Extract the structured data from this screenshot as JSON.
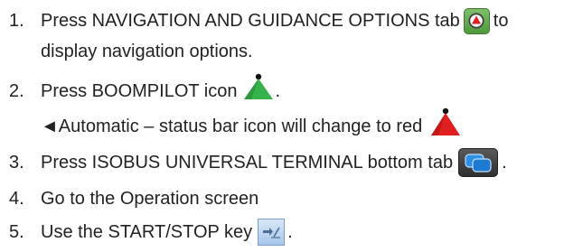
{
  "steps": [
    {
      "number": "1.",
      "text_a": "Press NAVIGATION AND GUIDANCE OPTIONS tab",
      "text_b": "to",
      "continuation": "display navigation options."
    },
    {
      "number": "2.",
      "text_a": "Press BOOMPILOT icon",
      "text_b": "."
    },
    {
      "note_arrow": "◄",
      "note_text": "Automatic – status bar icon will change to red"
    },
    {
      "number": "3.",
      "text_a": "Press ISOBUS UNIVERSAL TERMINAL bottom tab",
      "text_b": "."
    },
    {
      "number": "4.",
      "text_a": "Go to the Operation screen"
    },
    {
      "number": "5.",
      "text_a": "Use the START/STOP key",
      "text_b": "."
    }
  ],
  "colors": {
    "text": "#222222",
    "boompilot_green": "#36b24a",
    "boompilot_red": "#e02020",
    "tab_green": "#5aa845"
  },
  "icons": [
    "navigation-guidance-tab-icon",
    "boompilot-green-icon",
    "boompilot-red-icon",
    "isobus-universal-terminal-tab-icon",
    "start-stop-key-icon"
  ]
}
